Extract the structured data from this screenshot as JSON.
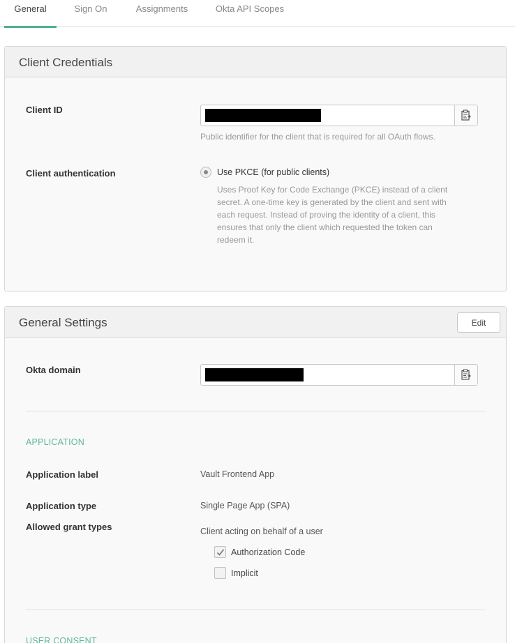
{
  "tabs": [
    {
      "label": "General"
    },
    {
      "label": "Sign On"
    },
    {
      "label": "Assignments"
    },
    {
      "label": "Okta API Scopes"
    }
  ],
  "client_credentials": {
    "title": "Client Credentials",
    "client_id_label": "Client ID",
    "client_id_help": "Public identifier for the client that is required for all OAuth flows.",
    "client_auth_label": "Client authentication",
    "pkce_label": "Use PKCE (for public clients)",
    "pkce_help": [
      "Uses Proof Key for Code Exchange (PKCE) instead of a client",
      "secret. A one-time key is generated by the client and sent with",
      "each request. Instead of proving the identity of a client, this",
      "ensures that only the client which requested the token can",
      "redeem it."
    ]
  },
  "general_settings": {
    "title": "General Settings",
    "edit_label": "Edit",
    "okta_domain_label": "Okta domain",
    "application_section": "APPLICATION",
    "app_label_label": "Application label",
    "app_label_value": "Vault Frontend App",
    "app_type_label": "Application type",
    "app_type_value": "Single Page App (SPA)",
    "grant_types_label": "Allowed grant types",
    "grant_types_sub": "Client acting on behalf of a user",
    "grant_options": [
      {
        "label": "Authorization Code",
        "checked": true
      },
      {
        "label": "Implicit",
        "checked": false
      }
    ],
    "user_consent_section": "USER CONSENT"
  },
  "colors": {
    "accent": "#4caf93",
    "section_head": "#5fb89a"
  },
  "icons": {
    "copy": "clipboard-icon",
    "check": "checkmark-icon"
  }
}
